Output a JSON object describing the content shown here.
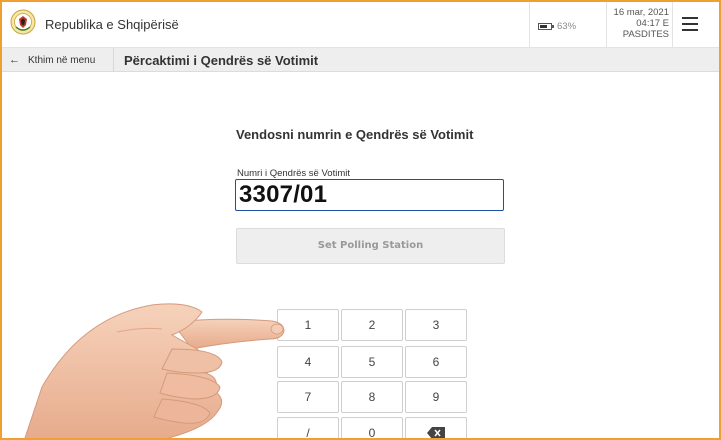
{
  "header": {
    "app_title": "Republika e Shqipërisë",
    "battery_label": "63%",
    "date": "16 mar, 2021",
    "time": "04:17 E",
    "period": "PASDITES",
    "menu_icon": "hamburger-menu-icon"
  },
  "nav": {
    "back_label": "Kthim në menu",
    "page_title": "Përcaktimi i Qendrës së Votimit"
  },
  "main": {
    "heading": "Vendosni numrin e Qendrës së Votimit",
    "field_label": "Numri i Qendrës së Votimit",
    "field_value": "3307/01",
    "set_button": "Set Polling Station"
  },
  "keypad": {
    "keys": [
      "1",
      "2",
      "3",
      "4",
      "5",
      "6",
      "7",
      "8",
      "9",
      "/",
      "0"
    ],
    "backspace_icon": "backspace-icon"
  },
  "colors": {
    "frame_border": "#f0a030",
    "field_border": "#1f4fa0",
    "navbar_bg": "#eeeeee"
  }
}
